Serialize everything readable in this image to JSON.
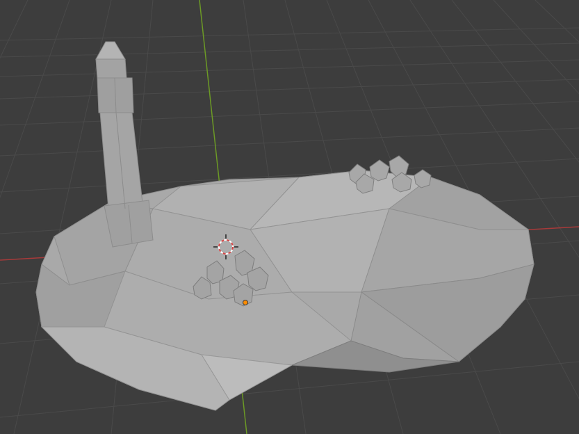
{
  "viewport": {
    "background_color": "#3d3d3d",
    "grid_color": "#4a4a4a",
    "x_axis_color": "#a83a3a",
    "y_axis_color": "#6c9a25",
    "mesh_base_color": "#a9a9a9",
    "mesh_edge_color": "#8d8d8d"
  },
  "scene": {
    "objects": [
      {
        "name": "terrain-mesh",
        "label": ""
      },
      {
        "name": "tower-mesh",
        "label": ""
      },
      {
        "name": "house-cluster-center",
        "label": ""
      },
      {
        "name": "house-cluster-back",
        "label": ""
      }
    ],
    "selected_origin_color": "#ff8c00",
    "cursor_icon": "3d-cursor-icon"
  }
}
